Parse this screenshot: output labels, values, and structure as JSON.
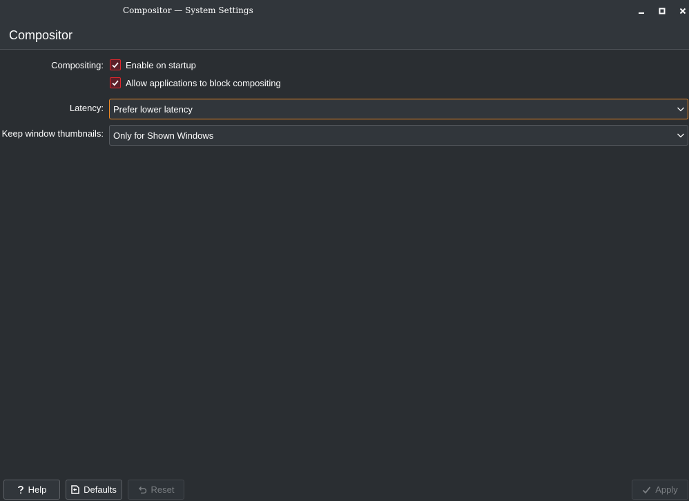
{
  "window": {
    "title": "Compositor — System Settings",
    "controls": {
      "minimize_icon": "minimize-icon",
      "maximize_icon": "maximize-icon",
      "close_icon": "close-icon"
    }
  },
  "header": {
    "title": "Compositor"
  },
  "form": {
    "compositing_label": "Compositing:",
    "enable_on_startup": {
      "label": "Enable on startup",
      "checked": true
    },
    "allow_block": {
      "label": "Allow applications to block compositing",
      "checked": true
    },
    "latency_label": "Latency:",
    "latency_value": "Prefer lower latency",
    "thumbnails_label": "Keep window thumbnails:",
    "thumbnails_value": "Only for Shown Windows"
  },
  "footer": {
    "help_label": "Help",
    "defaults_label": "Defaults",
    "reset_label": "Reset",
    "apply_label": "Apply"
  },
  "colors": {
    "background": "#2a2e32",
    "titlebar": "#31363b",
    "checkbox_accent": "#e3262c",
    "focus_accent": "#f08a24",
    "text": "#fcfcfc",
    "disabled_text": "#7b7f83"
  }
}
